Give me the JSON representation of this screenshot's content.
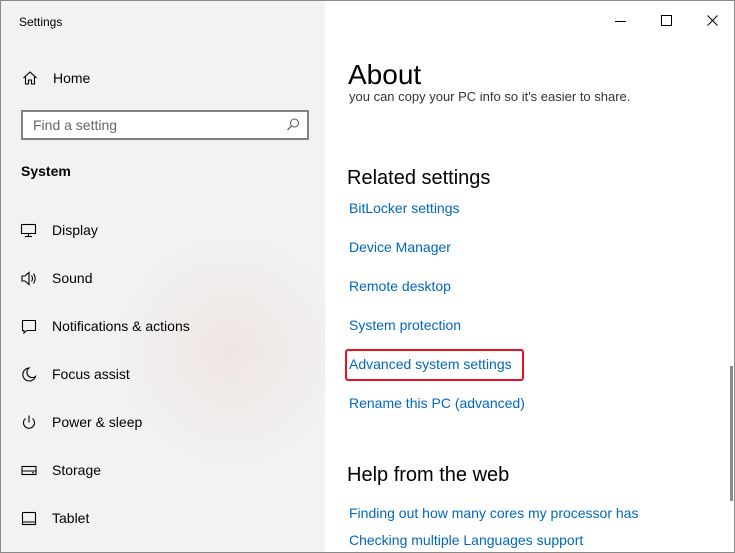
{
  "window": {
    "title": "Settings"
  },
  "sidebar": {
    "home_label": "Home",
    "search": {
      "placeholder": "Find a setting",
      "value": ""
    },
    "section_label": "System",
    "items": [
      {
        "label": "Display",
        "icon": "monitor-icon"
      },
      {
        "label": "Sound",
        "icon": "speaker-icon"
      },
      {
        "label": "Notifications & actions",
        "icon": "notification-icon"
      },
      {
        "label": "Focus assist",
        "icon": "moon-icon"
      },
      {
        "label": "Power & sleep",
        "icon": "power-icon"
      },
      {
        "label": "Storage",
        "icon": "storage-icon"
      },
      {
        "label": "Tablet",
        "icon": "tablet-icon"
      }
    ]
  },
  "main": {
    "title": "About",
    "cut_text": "you can copy your PC info so it's easier to share.",
    "related": {
      "heading": "Related settings",
      "links": [
        "BitLocker settings",
        "Device Manager",
        "Remote desktop",
        "System protection",
        "Advanced system settings",
        "Rename this PC (advanced)"
      ]
    },
    "help": {
      "heading": "Help from the web",
      "links": [
        "Finding out how many cores my processor has",
        "Checking multiple Languages support"
      ]
    }
  },
  "colors": {
    "link": "#0067c0",
    "highlight": "#e81123",
    "sidebar_bg": "#f2f2f2"
  }
}
